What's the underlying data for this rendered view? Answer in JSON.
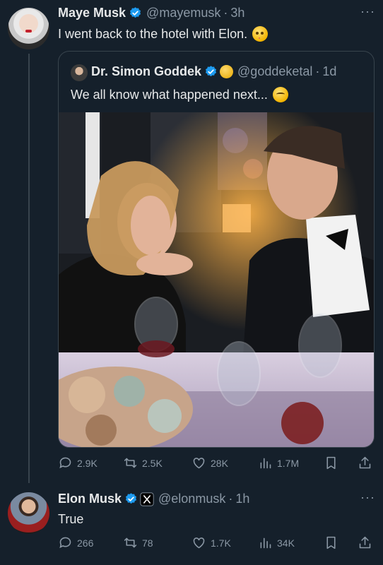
{
  "tweet": {
    "author_name": "Maye Musk",
    "handle": "@mayemusk",
    "separator": "·",
    "time": "3h",
    "text": "I went back to the hotel with Elon.",
    "emoji": "flushed-face-icon",
    "stats": {
      "replies": "2.9K",
      "reposts": "2.5K",
      "likes": "28K",
      "views": "1.7M"
    }
  },
  "quoted": {
    "author_name": "Dr. Simon Goddek",
    "handle": "@goddeketal",
    "separator": "·",
    "time": "1d",
    "text": "We all know what happened next...",
    "emoji": "smirking-face-icon"
  },
  "reply": {
    "author_name": "Elon Musk",
    "handle": "@elonmusk",
    "separator": "·",
    "time": "1h",
    "text": "True",
    "stats": {
      "replies": "266",
      "reposts": "78",
      "likes": "1.7K",
      "views": "34K"
    }
  },
  "more_label": "···",
  "colors": {
    "background": "#15202b",
    "verified_blue": "#1d9bf0",
    "muted": "#8b98a5",
    "text": "#e7e9ea",
    "border": "#38444d"
  }
}
